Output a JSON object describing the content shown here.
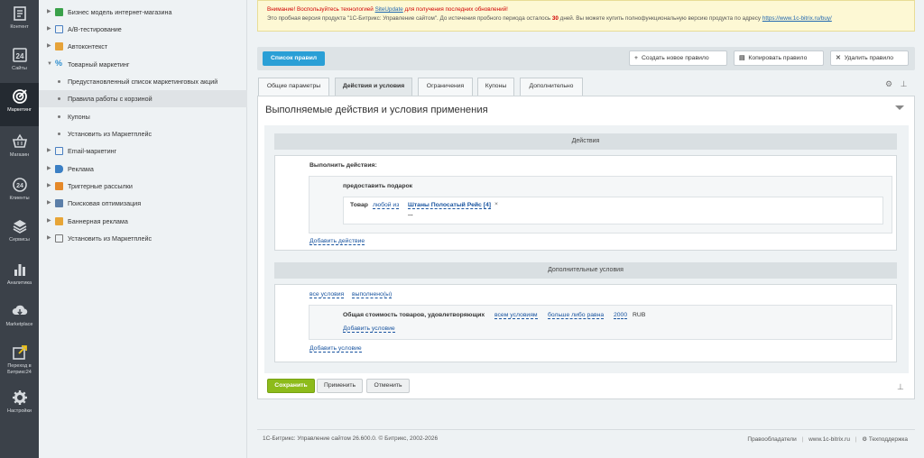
{
  "sidebar": {
    "items": [
      {
        "label": "Контент",
        "icon": "content-icon"
      },
      {
        "label": "Сайты",
        "icon": "sites-icon"
      },
      {
        "label": "Маркетинг",
        "icon": "target-icon"
      },
      {
        "label": "Магазин",
        "icon": "basket-icon"
      },
      {
        "label": "Клиенты",
        "icon": "clients-24-icon"
      },
      {
        "label": "Сервисы",
        "icon": "layers-icon"
      },
      {
        "label": "Аналитика",
        "icon": "bar-chart-icon"
      },
      {
        "label": "Marketplace",
        "icon": "cloud-download-icon"
      },
      {
        "label": "Переход в Битрикс24",
        "icon": "bitrix24-icon"
      },
      {
        "label": "Настройки",
        "icon": "gear-icon"
      }
    ]
  },
  "menu": {
    "items": [
      {
        "label": "Бизнес модель интернет-магазина"
      },
      {
        "label": "A/B-тестирование"
      },
      {
        "label": "Автоконтекст"
      },
      {
        "label": "Товарный маркетинг"
      },
      {
        "label": "Предустановленный список маркетинговых акций"
      },
      {
        "label": "Правила работы с корзиной"
      },
      {
        "label": "Купоны"
      },
      {
        "label": "Установить из Маркетплейс"
      },
      {
        "label": "Email-маркетинг"
      },
      {
        "label": "Реклама"
      },
      {
        "label": "Триггерные рассылки"
      },
      {
        "label": "Поисковая оптимизация"
      },
      {
        "label": "Баннерная реклама"
      },
      {
        "label": "Установить из Маркетплейс"
      }
    ]
  },
  "notice": {
    "line1_prefix": "Внимание! Воспользуйтесь технологией ",
    "line1_link": "SiteUpdate",
    "line1_suffix": " для получения последних обновлений!",
    "line2_prefix": "Это пробная версия продукта \"1С-Битрикс: Управление сайтом\". До истечения пробного периода осталось ",
    "days": "30",
    "line2_middle": " дней. Вы можете купить полнофункциональную версию продукта по адресу ",
    "line2_link": "https://www.1c-bitrix.ru/buy/"
  },
  "toolbar": {
    "list_label": "Список правил",
    "create_label": "Создать новое правило",
    "copy_label": "Копировать правило",
    "delete_label": "Удалить правило"
  },
  "tabs": [
    {
      "label": "Общие параметры"
    },
    {
      "label": "Действия и условия"
    },
    {
      "label": "Ограничения"
    },
    {
      "label": "Купоны"
    },
    {
      "label": "Дополнительно"
    }
  ],
  "panel": {
    "title": "Выполняемые действия и условия применения",
    "actions": {
      "header": "Действия",
      "do_label": "Выполнить действия:",
      "gift_label": "предоставить подарок",
      "product_label": "Товар",
      "any_of": "любой из",
      "product_value": "Штаны Полосатый Рейс [4]",
      "remove_glyph": "×",
      "more": "...",
      "add_action": "Добавить действие"
    },
    "conditions": {
      "header": "Дополнительные условия",
      "all_conditions": "все условия",
      "fulfilled": "выполнено(ы)",
      "total_label": "Общая стоимость товаров, удовлетворяющих",
      "all_conditions_2": "всем условиям",
      "compare": "больше либо равна",
      "amount": "2000",
      "currency": "RUB",
      "add_inner": "Добавить условие",
      "add_outer": "Добавить условие"
    }
  },
  "buttons": {
    "save": "Сохранить",
    "apply": "Применить",
    "cancel": "Отменить"
  },
  "footer": {
    "copyright": "1С-Битрикс: Управление сайтом 26.600.0. © Битрикс, 2002-2026",
    "rights": "Правообладатели",
    "site": "www.1c-bitrix.ru",
    "support": "Техподдержка"
  }
}
